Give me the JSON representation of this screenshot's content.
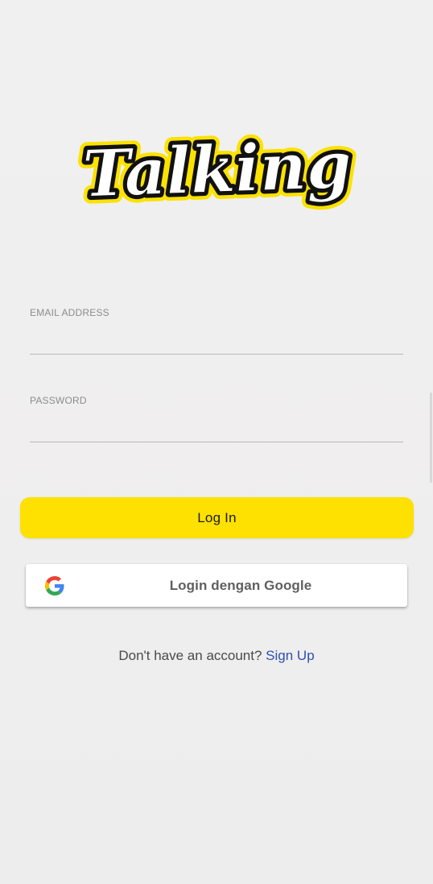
{
  "app": {
    "logo_text": "Talking"
  },
  "form": {
    "email": {
      "label": "EMAIL ADDRESS",
      "value": ""
    },
    "password": {
      "label": "PASSWORD",
      "value": ""
    }
  },
  "actions": {
    "login_label": "Log In",
    "google_label": "Login dengan Google",
    "signup_prompt": "Don't have an account?",
    "signup_link": "Sign Up"
  },
  "colors": {
    "accent_yellow": "#fee100",
    "link_blue": "#2e4fae",
    "background": "#efeeee"
  },
  "icons": {
    "google": "google-g-logo-icon"
  }
}
